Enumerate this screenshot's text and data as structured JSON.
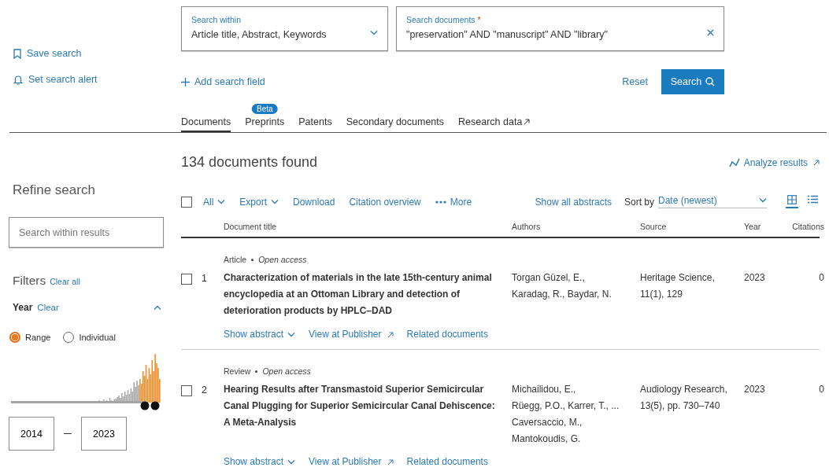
{
  "page_actions": [
    {
      "kind": "bookmark",
      "label": "Save search"
    },
    {
      "kind": "bell",
      "label": "Set search alert"
    }
  ],
  "search_within": {
    "label": "Search within",
    "value": "Article title, Abstract, Keywords"
  },
  "search_documents": {
    "label": "Search documents",
    "required_mark": "*",
    "value": "\"preservation\" AND \"manuscript\" AND \"library\""
  },
  "add_field": "Add search field",
  "reset": "Reset",
  "search_button": "Search",
  "tabs": [
    {
      "label": "Documents",
      "selected": true,
      "external": false
    },
    {
      "label": "Preprints",
      "selected": false,
      "external": false,
      "badge": "Beta"
    },
    {
      "label": "Patents",
      "selected": false,
      "external": false
    },
    {
      "label": "Secondary documents",
      "selected": false,
      "external": false
    },
    {
      "label": "Research data",
      "selected": false,
      "external": true
    }
  ],
  "results_count": "134 documents found",
  "analyze": "Analyze results",
  "sidebar": {
    "title": "Refine search",
    "search_placeholder": "Search within results",
    "filters": "Filters",
    "clear_all": "Clear all",
    "year": {
      "label": "Year",
      "clear": "Clear",
      "expanded": true,
      "modes": [
        {
          "label": "Range",
          "selected": true
        },
        {
          "label": "Individual",
          "selected": false
        }
      ],
      "from": "2014",
      "to": "2023"
    }
  },
  "toolbar": {
    "select_all_checked": false,
    "all": "All",
    "export": "Export",
    "download": "Download",
    "citation_overview": "Citation overview",
    "more": "More",
    "show_all_abstracts": "Show all abstracts",
    "sort_label": "Sort by",
    "sort_value": "Date (newest)",
    "views": [
      {
        "kind": "grid",
        "selected": true
      },
      {
        "kind": "list",
        "selected": false
      }
    ]
  },
  "table": {
    "columns": [
      "Document title",
      "Authors",
      "Source",
      "Year",
      "Citations"
    ],
    "rows": [
      {
        "checked": false,
        "number": "1",
        "doc_type": "Article",
        "access": "Open access",
        "title": "Characterization of materials in the late 15th-century animal encyclopedia at an Ottoman Library and detection of deterioration products by HPLC–DAD",
        "authors": [
          "Torgan Güzel, E.,",
          "Karadag, R., Baydar, N."
        ],
        "source": [
          "Heritage Science,",
          "11(1), 129"
        ],
        "year": "2023",
        "citations": "0",
        "links": [
          "Show abstract",
          "View at Publisher",
          "Related documents"
        ]
      },
      {
        "checked": false,
        "number": "2",
        "doc_type": "Review",
        "access": "Open access",
        "title": "Hearing Results after Transmastoid Superior Semicircular Canal Plugging for Superior Semicircular Canal Dehiscence: A Meta-Analysis",
        "authors": [
          "Michailidou, E.,",
          "Rüegg, P.O., Karrer, T., ...",
          "Caversaccio, M.,",
          "Mantokoudis, G."
        ],
        "source": [
          "Audiology Research,",
          "13(5), pp. 730–740"
        ],
        "year": "2023",
        "citations": "0",
        "links": [
          "Show abstract",
          "View at Publisher",
          "Related documents"
        ]
      }
    ]
  }
}
